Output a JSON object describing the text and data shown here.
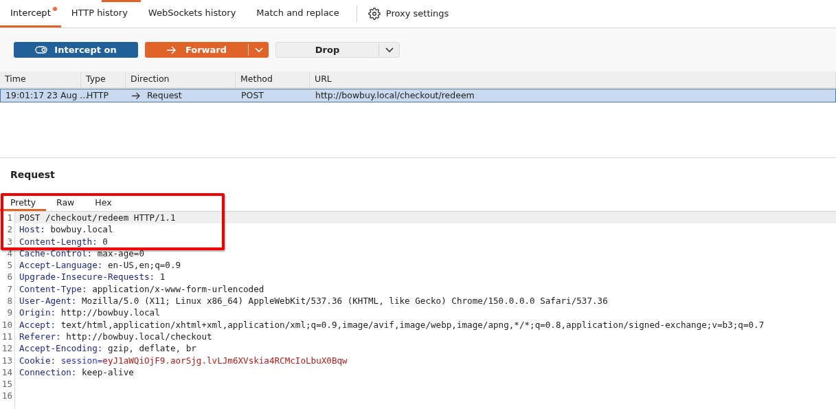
{
  "tabs": [
    {
      "label": "Intercept",
      "selected": true,
      "notification": true
    },
    {
      "label": "HTTP history",
      "selected": false,
      "notification": false
    },
    {
      "label": "WebSockets history",
      "selected": false,
      "notification": false
    },
    {
      "label": "Match and replace",
      "selected": false,
      "notification": false
    }
  ],
  "settings_tab": {
    "label": "Proxy settings"
  },
  "toolbar": {
    "intercept": {
      "label": "Intercept on",
      "on": true
    },
    "forward": {
      "label": "Forward"
    },
    "drop": {
      "label": "Drop"
    }
  },
  "table": {
    "columns": [
      "Time",
      "Type",
      "Direction",
      "Method",
      "URL"
    ],
    "rows": [
      {
        "selected": true,
        "cells": [
          "19:01:17 23 Aug ...",
          "HTTP",
          "Request",
          "POST",
          "http://bowbuy.local/checkout/redeem"
        ]
      }
    ]
  },
  "request": {
    "title": "Request",
    "view_tabs": [
      {
        "label": "Pretty",
        "selected": true
      },
      {
        "label": "Raw",
        "selected": false
      },
      {
        "label": "Hex",
        "selected": false
      }
    ],
    "lines": [
      {
        "number": "1",
        "kind": "request_line",
        "text": "POST /checkout/redeem HTTP/1.1",
        "current": true
      },
      {
        "number": "2",
        "kind": "header",
        "name": "Host:",
        "value": "bowbuy.local",
        "current": false
      },
      {
        "number": "3",
        "kind": "header",
        "name": "Content-Length:",
        "value": "0",
        "current": false
      },
      {
        "number": "4",
        "kind": "header",
        "name": "Cache-Control:",
        "value": "max-age=0",
        "current": false
      },
      {
        "number": "5",
        "kind": "header",
        "name": "Accept-Language:",
        "value": "en-US,en;q=0.9",
        "current": false
      },
      {
        "number": "6",
        "kind": "header",
        "name": "Upgrade-Insecure-Requests:",
        "value": "1",
        "current": false
      },
      {
        "number": "7",
        "kind": "header",
        "name": "Content-Type:",
        "value": "application/x-www-form-urlencoded",
        "current": false
      },
      {
        "number": "8",
        "kind": "header",
        "name": "User-Agent:",
        "value": "Mozilla/5.0 (X11; Linux x86_64) AppleWebKit/537.36 (KHTML, like Gecko) Chrome/150.0.0.0 Safari/537.36",
        "current": false
      },
      {
        "number": "9",
        "kind": "header",
        "name": "Origin:",
        "value": "http://bowbuy.local",
        "current": false
      },
      {
        "number": "10",
        "kind": "header",
        "name": "Accept:",
        "value": "text/html,application/xhtml+xml,application/xml;q=0.9,image/avif,image/webp,image/apng,*/*;q=0.8,application/signed-exchange;v=b3;q=0.7",
        "current": false
      },
      {
        "number": "11",
        "kind": "header",
        "name": "Referer:",
        "value": "http://bowbuy.local/checkout",
        "current": false
      },
      {
        "number": "12",
        "kind": "header",
        "name": "Accept-Encoding:",
        "value": "gzip, deflate, br",
        "current": false
      },
      {
        "number": "13",
        "kind": "cookie",
        "name": "Cookie:",
        "cookie_name": "session=",
        "cookie_value": "eyJ1aWQiOjF9.aorSjg.lvLJm6XVskia4RCMcIoLbuX0Bqw",
        "current": false
      },
      {
        "number": "14",
        "kind": "header",
        "name": "Connection:",
        "value": "keep-alive",
        "current": false
      },
      {
        "number": "15",
        "kind": "empty",
        "current": false
      },
      {
        "number": "16",
        "kind": "empty",
        "current": false
      }
    ]
  },
  "annotations": [
    {
      "kind": "rectangle"
    }
  ]
}
